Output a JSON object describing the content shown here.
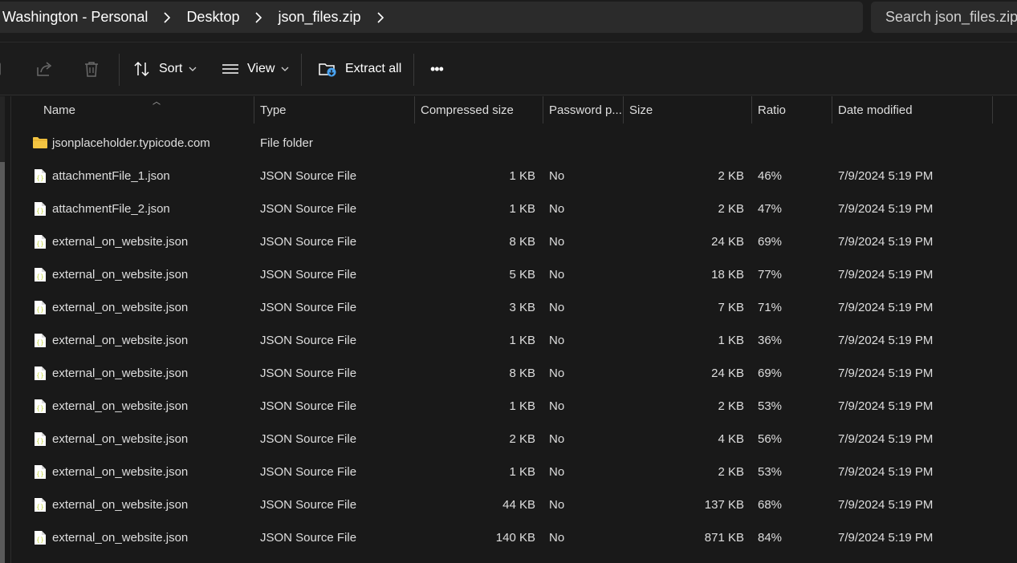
{
  "breadcrumb": [
    "Washington - Personal",
    "Desktop",
    "json_files.zip"
  ],
  "search": {
    "placeholder": "Search json_files.zip"
  },
  "toolbar": {
    "sort_label": "Sort",
    "view_label": "View",
    "extract_label": "Extract all",
    "more_label": "•••"
  },
  "columns": {
    "name": "Name",
    "type": "Type",
    "compressed": "Compressed size",
    "password": "Password p...",
    "size": "Size",
    "ratio": "Ratio",
    "date": "Date modified"
  },
  "rows": [
    {
      "icon": "folder-icon",
      "name": "jsonplaceholder.typicode.com",
      "type": "File folder",
      "compressed": "",
      "password": "",
      "size": "",
      "ratio": "",
      "date": ""
    },
    {
      "icon": "json-file-icon",
      "name": "attachmentFile_1.json",
      "type": "JSON Source File",
      "compressed": "1 KB",
      "password": "No",
      "size": "2 KB",
      "ratio": "46%",
      "date": "7/9/2024 5:19 PM"
    },
    {
      "icon": "json-file-icon",
      "name": "attachmentFile_2.json",
      "type": "JSON Source File",
      "compressed": "1 KB",
      "password": "No",
      "size": "2 KB",
      "ratio": "47%",
      "date": "7/9/2024 5:19 PM"
    },
    {
      "icon": "json-file-icon",
      "name": "external_on_website.json",
      "type": "JSON Source File",
      "compressed": "8 KB",
      "password": "No",
      "size": "24 KB",
      "ratio": "69%",
      "date": "7/9/2024 5:19 PM"
    },
    {
      "icon": "json-file-icon",
      "name": "external_on_website.json",
      "type": "JSON Source File",
      "compressed": "5 KB",
      "password": "No",
      "size": "18 KB",
      "ratio": "77%",
      "date": "7/9/2024 5:19 PM"
    },
    {
      "icon": "json-file-icon",
      "name": "external_on_website.json",
      "type": "JSON Source File",
      "compressed": "3 KB",
      "password": "No",
      "size": "7 KB",
      "ratio": "71%",
      "date": "7/9/2024 5:19 PM"
    },
    {
      "icon": "json-file-icon",
      "name": "external_on_website.json",
      "type": "JSON Source File",
      "compressed": "1 KB",
      "password": "No",
      "size": "1 KB",
      "ratio": "36%",
      "date": "7/9/2024 5:19 PM"
    },
    {
      "icon": "json-file-icon",
      "name": "external_on_website.json",
      "type": "JSON Source File",
      "compressed": "8 KB",
      "password": "No",
      "size": "24 KB",
      "ratio": "69%",
      "date": "7/9/2024 5:19 PM"
    },
    {
      "icon": "json-file-icon",
      "name": "external_on_website.json",
      "type": "JSON Source File",
      "compressed": "1 KB",
      "password": "No",
      "size": "2 KB",
      "ratio": "53%",
      "date": "7/9/2024 5:19 PM"
    },
    {
      "icon": "json-file-icon",
      "name": "external_on_website.json",
      "type": "JSON Source File",
      "compressed": "2 KB",
      "password": "No",
      "size": "4 KB",
      "ratio": "56%",
      "date": "7/9/2024 5:19 PM"
    },
    {
      "icon": "json-file-icon",
      "name": "external_on_website.json",
      "type": "JSON Source File",
      "compressed": "1 KB",
      "password": "No",
      "size": "2 KB",
      "ratio": "53%",
      "date": "7/9/2024 5:19 PM"
    },
    {
      "icon": "json-file-icon",
      "name": "external_on_website.json",
      "type": "JSON Source File",
      "compressed": "44 KB",
      "password": "No",
      "size": "137 KB",
      "ratio": "68%",
      "date": "7/9/2024 5:19 PM"
    },
    {
      "icon": "json-file-icon",
      "name": "external_on_website.json",
      "type": "JSON Source File",
      "compressed": "140 KB",
      "password": "No",
      "size": "871 KB",
      "ratio": "84%",
      "date": "7/9/2024 5:19 PM"
    }
  ],
  "colors": {
    "folder": "#f4c542",
    "json_brace": "#c8d84a",
    "accent": "#4aa3f0"
  }
}
